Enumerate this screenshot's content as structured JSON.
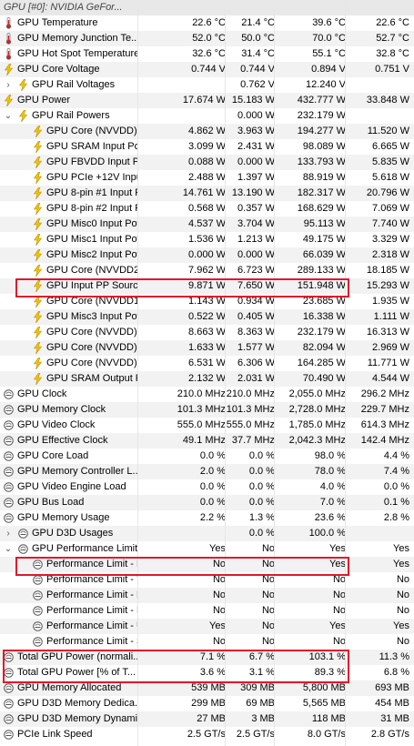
{
  "header": {
    "title": "GPU [#0]: NVIDIA GeFor..."
  },
  "rows": [
    {
      "label": "GPU Temperature",
      "icon": "thermometer-icon",
      "indent": 0,
      "toggle": "",
      "values": [
        "22.6 °C",
        "21.4 °C",
        "39.6 °C",
        "22.6 °C"
      ]
    },
    {
      "label": "GPU Memory Junction Te...",
      "icon": "thermometer-icon",
      "indent": 0,
      "toggle": "",
      "values": [
        "52.0 °C",
        "50.0 °C",
        "70.0 °C",
        "52.7 °C"
      ]
    },
    {
      "label": "GPU Hot Spot Temperature",
      "icon": "thermometer-icon",
      "indent": 0,
      "toggle": "",
      "values": [
        "32.6 °C",
        "31.4 °C",
        "55.1 °C",
        "32.8 °C"
      ]
    },
    {
      "label": "GPU Core Voltage",
      "icon": "lightning-icon",
      "indent": 0,
      "toggle": "",
      "values": [
        "0.744 V",
        "0.744 V",
        "0.894 V",
        "0.751 V"
      ]
    },
    {
      "label": "GPU Rail Voltages",
      "icon": "lightning-icon",
      "indent": 1,
      "toggle": "›",
      "values": [
        "",
        "0.762 V",
        "12.240 V",
        ""
      ]
    },
    {
      "label": "GPU Power",
      "icon": "lightning-icon",
      "indent": 0,
      "toggle": "",
      "values": [
        "17.674 W",
        "15.183 W",
        "432.777 W",
        "33.848 W"
      ]
    },
    {
      "label": "GPU Rail Powers",
      "icon": "lightning-icon",
      "indent": 1,
      "toggle": "⌄",
      "values": [
        "",
        "0.000 W",
        "232.179 W",
        ""
      ]
    },
    {
      "label": "GPU Core (NVVDD) In...",
      "icon": "lightning-icon",
      "indent": 2,
      "toggle": "",
      "values": [
        "4.862 W",
        "3.963 W",
        "194.277 W",
        "11.520 W"
      ]
    },
    {
      "label": "GPU SRAM Input Pow...",
      "icon": "lightning-icon",
      "indent": 2,
      "toggle": "",
      "values": [
        "3.099 W",
        "2.431 W",
        "98.089 W",
        "6.665 W"
      ]
    },
    {
      "label": "GPU FBVDD Input Po...",
      "icon": "lightning-icon",
      "indent": 2,
      "toggle": "",
      "values": [
        "0.088 W",
        "0.000 W",
        "133.793 W",
        "5.835 W"
      ]
    },
    {
      "label": "GPU PCIe +12V Input...",
      "icon": "lightning-icon",
      "indent": 2,
      "toggle": "",
      "values": [
        "2.488 W",
        "1.397 W",
        "88.919 W",
        "5.618 W"
      ]
    },
    {
      "label": "GPU 8-pin #1 Input P...",
      "icon": "lightning-icon",
      "indent": 2,
      "toggle": "",
      "values": [
        "14.761 W",
        "13.190 W",
        "182.317 W",
        "20.796 W"
      ]
    },
    {
      "label": "GPU 8-pin #2 Input P...",
      "icon": "lightning-icon",
      "indent": 2,
      "toggle": "",
      "values": [
        "0.568 W",
        "0.357 W",
        "168.629 W",
        "7.069 W"
      ]
    },
    {
      "label": "GPU Misc0 Input Power",
      "icon": "lightning-icon",
      "indent": 2,
      "toggle": "",
      "values": [
        "4.537 W",
        "3.704 W",
        "95.113 W",
        "7.740 W"
      ]
    },
    {
      "label": "GPU Misc1 Input Power",
      "icon": "lightning-icon",
      "indent": 2,
      "toggle": "",
      "values": [
        "1.536 W",
        "1.213 W",
        "49.175 W",
        "3.329 W"
      ]
    },
    {
      "label": "GPU Misc2 Input Power",
      "icon": "lightning-icon",
      "indent": 2,
      "toggle": "",
      "values": [
        "0.000 W",
        "0.000 W",
        "66.039 W",
        "2.318 W"
      ]
    },
    {
      "label": "GPU Core (NVVDD2) I...",
      "icon": "lightning-icon",
      "indent": 2,
      "toggle": "",
      "values": [
        "7.962 W",
        "6.723 W",
        "289.133 W",
        "18.185 W"
      ]
    },
    {
      "label": "GPU Input PP Source ...",
      "icon": "lightning-icon",
      "indent": 2,
      "toggle": "",
      "values": [
        "9.871 W",
        "7.650 W",
        "151.948 W",
        "15.293 W"
      ]
    },
    {
      "label": "GPU Core (NVVDD1) I...",
      "icon": "lightning-icon",
      "indent": 2,
      "toggle": "",
      "values": [
        "1.143 W",
        "0.934 W",
        "23.685 W",
        "1.935 W"
      ]
    },
    {
      "label": "GPU Misc3 Input Pow...",
      "icon": "lightning-icon",
      "indent": 2,
      "toggle": "",
      "values": [
        "0.522 W",
        "0.405 W",
        "16.338 W",
        "1.111 W"
      ]
    },
    {
      "label": "GPU Core (NVVDD) O...",
      "icon": "lightning-icon",
      "indent": 2,
      "toggle": "",
      "values": [
        "8.663 W",
        "8.363 W",
        "232.179 W",
        "16.313 W"
      ]
    },
    {
      "label": "GPU Core (NVVDD) O...",
      "icon": "lightning-icon",
      "indent": 2,
      "toggle": "",
      "values": [
        "1.633 W",
        "1.577 W",
        "82.094 W",
        "2.969 W"
      ]
    },
    {
      "label": "GPU Core (NVVDD) O...",
      "icon": "lightning-icon",
      "indent": 2,
      "toggle": "",
      "values": [
        "6.531 W",
        "6.306 W",
        "164.285 W",
        "11.771 W"
      ]
    },
    {
      "label": "GPU SRAM Output Po...",
      "icon": "lightning-icon",
      "indent": 2,
      "toggle": "",
      "values": [
        "2.132 W",
        "2.031 W",
        "70.490 W",
        "4.544 W"
      ]
    },
    {
      "label": "GPU Clock",
      "icon": "gauge-icon",
      "indent": 0,
      "toggle": "",
      "values": [
        "210.0 MHz",
        "210.0 MHz",
        "2,055.0 MHz",
        "296.2 MHz"
      ]
    },
    {
      "label": "GPU Memory Clock",
      "icon": "gauge-icon",
      "indent": 0,
      "toggle": "",
      "values": [
        "101.3 MHz",
        "101.3 MHz",
        "2,728.0 MHz",
        "229.7 MHz"
      ]
    },
    {
      "label": "GPU Video Clock",
      "icon": "gauge-icon",
      "indent": 0,
      "toggle": "",
      "values": [
        "555.0 MHz",
        "555.0 MHz",
        "1,785.0 MHz",
        "614.3 MHz"
      ]
    },
    {
      "label": "GPU Effective Clock",
      "icon": "gauge-icon",
      "indent": 0,
      "toggle": "",
      "values": [
        "49.1 MHz",
        "37.7 MHz",
        "2,042.3 MHz",
        "142.4 MHz"
      ]
    },
    {
      "label": "GPU Core Load",
      "icon": "gauge-icon",
      "indent": 0,
      "toggle": "",
      "values": [
        "0.0 %",
        "0.0 %",
        "98.0 %",
        "4.4 %"
      ]
    },
    {
      "label": "GPU Memory Controller L...",
      "icon": "gauge-icon",
      "indent": 0,
      "toggle": "",
      "values": [
        "2.0 %",
        "0.0 %",
        "78.0 %",
        "7.4 %"
      ]
    },
    {
      "label": "GPU Video Engine Load",
      "icon": "gauge-icon",
      "indent": 0,
      "toggle": "",
      "values": [
        "0.0 %",
        "0.0 %",
        "4.0 %",
        "0.0 %"
      ]
    },
    {
      "label": "GPU Bus Load",
      "icon": "gauge-icon",
      "indent": 0,
      "toggle": "",
      "values": [
        "0.0 %",
        "0.0 %",
        "7.0 %",
        "0.1 %"
      ]
    },
    {
      "label": "GPU Memory Usage",
      "icon": "gauge-icon",
      "indent": 0,
      "toggle": "",
      "values": [
        "2.2 %",
        "1.3 %",
        "23.6 %",
        "2.8 %"
      ]
    },
    {
      "label": "GPU D3D Usages",
      "icon": "gauge-icon",
      "indent": 1,
      "toggle": "›",
      "values": [
        "",
        "0.0 %",
        "100.0 %",
        ""
      ]
    },
    {
      "label": "GPU Performance Limits",
      "icon": "gauge-icon",
      "indent": 1,
      "toggle": "⌄",
      "values": [
        "Yes",
        "No",
        "Yes",
        "Yes"
      ]
    },
    {
      "label": "Performance Limit - P...",
      "icon": "gauge-icon",
      "indent": 2,
      "toggle": "",
      "values": [
        "No",
        "No",
        "Yes",
        "Yes"
      ]
    },
    {
      "label": "Performance Limit - T...",
      "icon": "gauge-icon",
      "indent": 2,
      "toggle": "",
      "values": [
        "No",
        "No",
        "No",
        "No"
      ]
    },
    {
      "label": "Performance Limit - R...",
      "icon": "gauge-icon",
      "indent": 2,
      "toggle": "",
      "values": [
        "No",
        "No",
        "No",
        "No"
      ]
    },
    {
      "label": "Performance Limit - M...",
      "icon": "gauge-icon",
      "indent": 2,
      "toggle": "",
      "values": [
        "No",
        "No",
        "No",
        "No"
      ]
    },
    {
      "label": "Performance Limit - U...",
      "icon": "gauge-icon",
      "indent": 2,
      "toggle": "",
      "values": [
        "Yes",
        "No",
        "Yes",
        "Yes"
      ]
    },
    {
      "label": "Performance Limit - S...",
      "icon": "gauge-icon",
      "indent": 2,
      "toggle": "",
      "values": [
        "No",
        "No",
        "No",
        "No"
      ]
    },
    {
      "label": "Total GPU Power (normali...",
      "icon": "gauge-icon",
      "indent": 0,
      "toggle": "",
      "values": [
        "7.1 %",
        "6.7 %",
        "103.1 %",
        "11.3 %"
      ]
    },
    {
      "label": "Total GPU Power [% of T...",
      "icon": "gauge-icon",
      "indent": 0,
      "toggle": "",
      "values": [
        "3.6 %",
        "3.1 %",
        "89.3 %",
        "6.8 %"
      ]
    },
    {
      "label": "GPU Memory Allocated",
      "icon": "gauge-icon",
      "indent": 0,
      "toggle": "",
      "values": [
        "539 MB",
        "309 MB",
        "5,800 MB",
        "693 MB"
      ]
    },
    {
      "label": "GPU D3D Memory Dedica...",
      "icon": "gauge-icon",
      "indent": 0,
      "toggle": "",
      "values": [
        "299 MB",
        "69 MB",
        "5,565 MB",
        "454 MB"
      ]
    },
    {
      "label": "GPU D3D Memory Dynamic",
      "icon": "gauge-icon",
      "indent": 0,
      "toggle": "",
      "values": [
        "27 MB",
        "3 MB",
        "118 MB",
        "31 MB"
      ]
    },
    {
      "label": "PCIe Link Speed",
      "icon": "gauge-icon",
      "indent": 0,
      "toggle": "",
      "values": [
        "2.5 GT/s",
        "2.5 GT/s",
        "8.0 GT/s",
        "2.8 GT/s"
      ]
    }
  ],
  "colors": {
    "highlight": "#e0182d",
    "lightning": "#f5c400",
    "thermo": "#cc2222",
    "gauge": "#555555",
    "alt_row": "#f2f2f2"
  }
}
